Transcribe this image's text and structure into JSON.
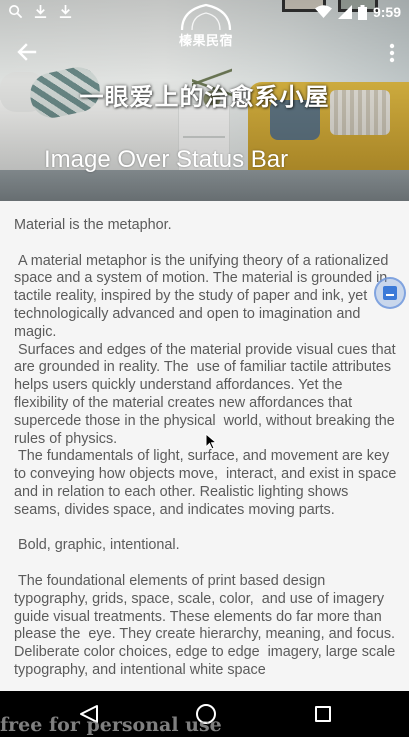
{
  "status_bar": {
    "time": "9:59",
    "left_icons": [
      "search-icon",
      "download-icon",
      "download-icon"
    ],
    "right_icons": [
      "wifi-icon",
      "signal-icon",
      "battery-icon"
    ]
  },
  "logo": {
    "text": "榛果民宿"
  },
  "toolbar": {
    "title": "Image Over Status Bar",
    "back_icon": "arrow-left-icon",
    "menu_icon": "more-vert-icon"
  },
  "banner": {
    "text": "一眼爱上的治愈系小屋"
  },
  "article": {
    "text": "Material is the metaphor.\n\n A material metaphor is the unifying theory of a rationalized space and a system of motion. The material is grounded in tactile reality, inspired by the study of paper and ink, yet  technologically advanced and open to imagination and magic.\n Surfaces and edges of the material provide visual cues that are grounded in reality. The  use of familiar tactile attributes helps users quickly understand affordances. Yet the  flexibility of the material creates new affordances that supercede those in the physical  world, without breaking the rules of physics.\n The fundamentals of light, surface, and movement are key to conveying how objects move,  interact, and exist in space and in relation to each other. Realistic lighting shows  seams, divides space, and indicates moving parts.\n\n Bold, graphic, intentional.\n\n The foundational elements of print based design typography, grids, space, scale, color,  and use of imagery guide visual treatments. These elements do far more than please the  eye. They create hierarchy, meaning, and focus. Deliberate color choices, edge to edge  imagery, large scale typography, and intentional white space"
  },
  "watermark": {
    "text": "free for personal use"
  },
  "navbar": {
    "back_icon": "nav-back-icon",
    "home_icon": "nav-home-icon",
    "recent_icon": "nav-recent-icon"
  },
  "colors": {
    "body_text": "#5b5b5b",
    "background": "#f5f5f5",
    "fab_accent": "#3b7ad8"
  }
}
